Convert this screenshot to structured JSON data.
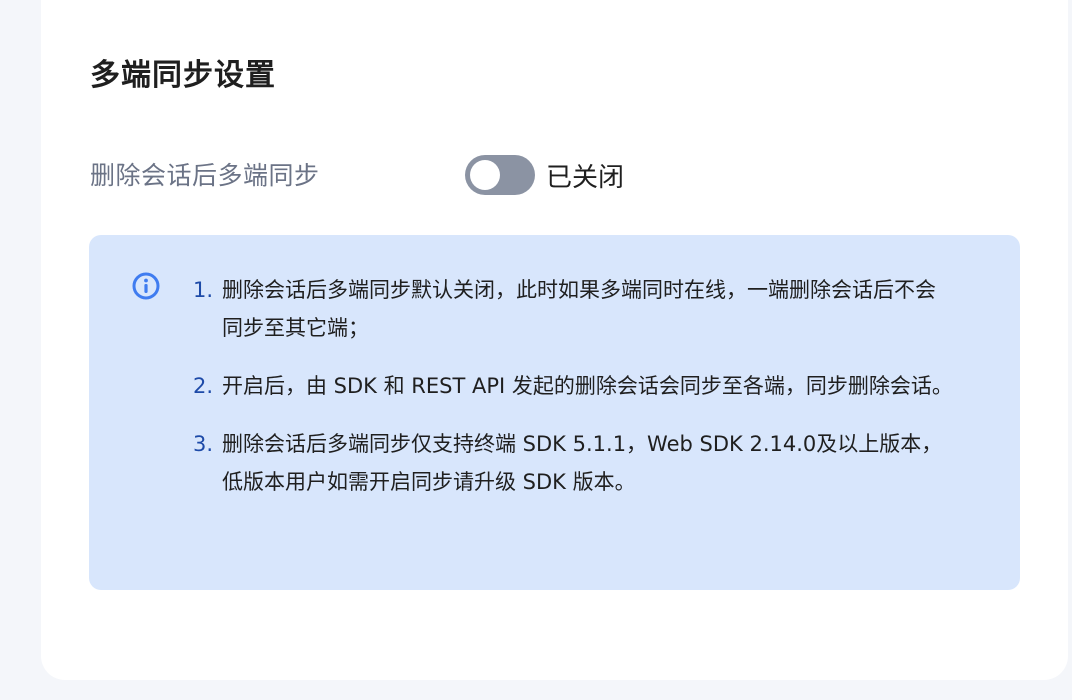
{
  "title": "多端同步设置",
  "setting": {
    "label": "删除会话后多端同步",
    "state_text": "已关闭",
    "enabled": false
  },
  "notes": [
    {
      "num": "1.",
      "text": "删除会话后多端同步默认关闭，此时如果多端同时在线，一端删除会话后不会同步至其它端；"
    },
    {
      "num": "2.",
      "text": "开启后，由 SDK 和 REST API 发起的删除会话会同步至各端，同步删除会话。"
    },
    {
      "num": "3.",
      "text": "删除会话后多端同步仅支持终端 SDK 5.1.1，Web SDK 2.14.0及以上版本，低版本用户如需开启同步请升级 SDK 版本。"
    }
  ],
  "icons": {
    "info": "info-circle-icon"
  },
  "colors": {
    "accent": "#3f7cf0",
    "info_background": "#d8e6fc",
    "switch_off": "#8b93a3",
    "label": "#6b7386"
  }
}
